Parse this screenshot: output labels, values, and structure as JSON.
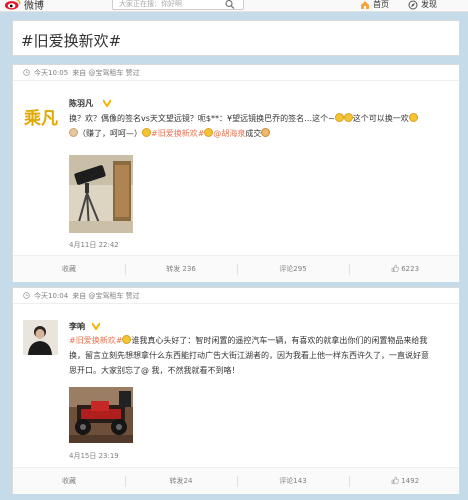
{
  "topbar": {
    "logo_text": "微博",
    "search_placeholder": "大家正在搜：你好啊",
    "nav": [
      {
        "label": "首页",
        "icon": "home-icon"
      },
      {
        "label": "发现",
        "icon": "discover-icon"
      }
    ]
  },
  "topic": {
    "title": "#旧爱换新欢#"
  },
  "posts": [
    {
      "time": "今天10:05",
      "source": "来自 @宝驾租车 赞过",
      "user": "陈羽凡",
      "text_line1": "换？欢？偶像的签名vs天文望远镜？呃$**：¥望远镜换巴乔的签名…这个~",
      "text_line1_tail": "这个可以换一欢",
      "text_line2_a": "（赚了，呵呵—）",
      "text_line2_tag": "#旧爱换新欢#",
      "text_line2_at": "@胡海泉",
      "text_line2_end": "成交",
      "date": "4月11日 22:42",
      "actions": {
        "fav": "收藏",
        "repost": "转发 236",
        "comment": "评论295",
        "like": "6223"
      }
    },
    {
      "time": "今天10:04",
      "source": "来自 @宝驾租车 赞过",
      "user": "李响",
      "text_tag": "#旧爱换新欢#",
      "text_line1": "谁我真心头好了：智时闲置的遥控汽车一辆，有喜欢的就拿出你们的闲置物品来给我",
      "text_line2": "换，留言立刻先想想拿什么东西能打动广告大街江湖者的，因为我看上他一样东西许久了，一直说好意",
      "text_line3": "思开口。大家别忘了@ 我，不然我就看不到咯！",
      "date": "4月15日 23:19",
      "actions": {
        "fav": "收藏",
        "repost": "转发24",
        "comment": "评论143",
        "like": "1492"
      }
    }
  ],
  "colors": {
    "accent": "#eb7350",
    "background": "#c6dbe9"
  }
}
